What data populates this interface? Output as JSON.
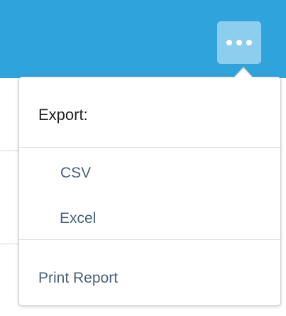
{
  "toolbar": {
    "more_button_icon": "more-horizontal-icon",
    "accent_color": "#2fa4dc"
  },
  "export_menu": {
    "header": "Export:",
    "items": [
      {
        "label": "CSV"
      },
      {
        "label": "Excel"
      }
    ],
    "print_label": "Print Report"
  },
  "colors": {
    "menu_text": "#4a5f7a",
    "header_text": "#222222"
  }
}
